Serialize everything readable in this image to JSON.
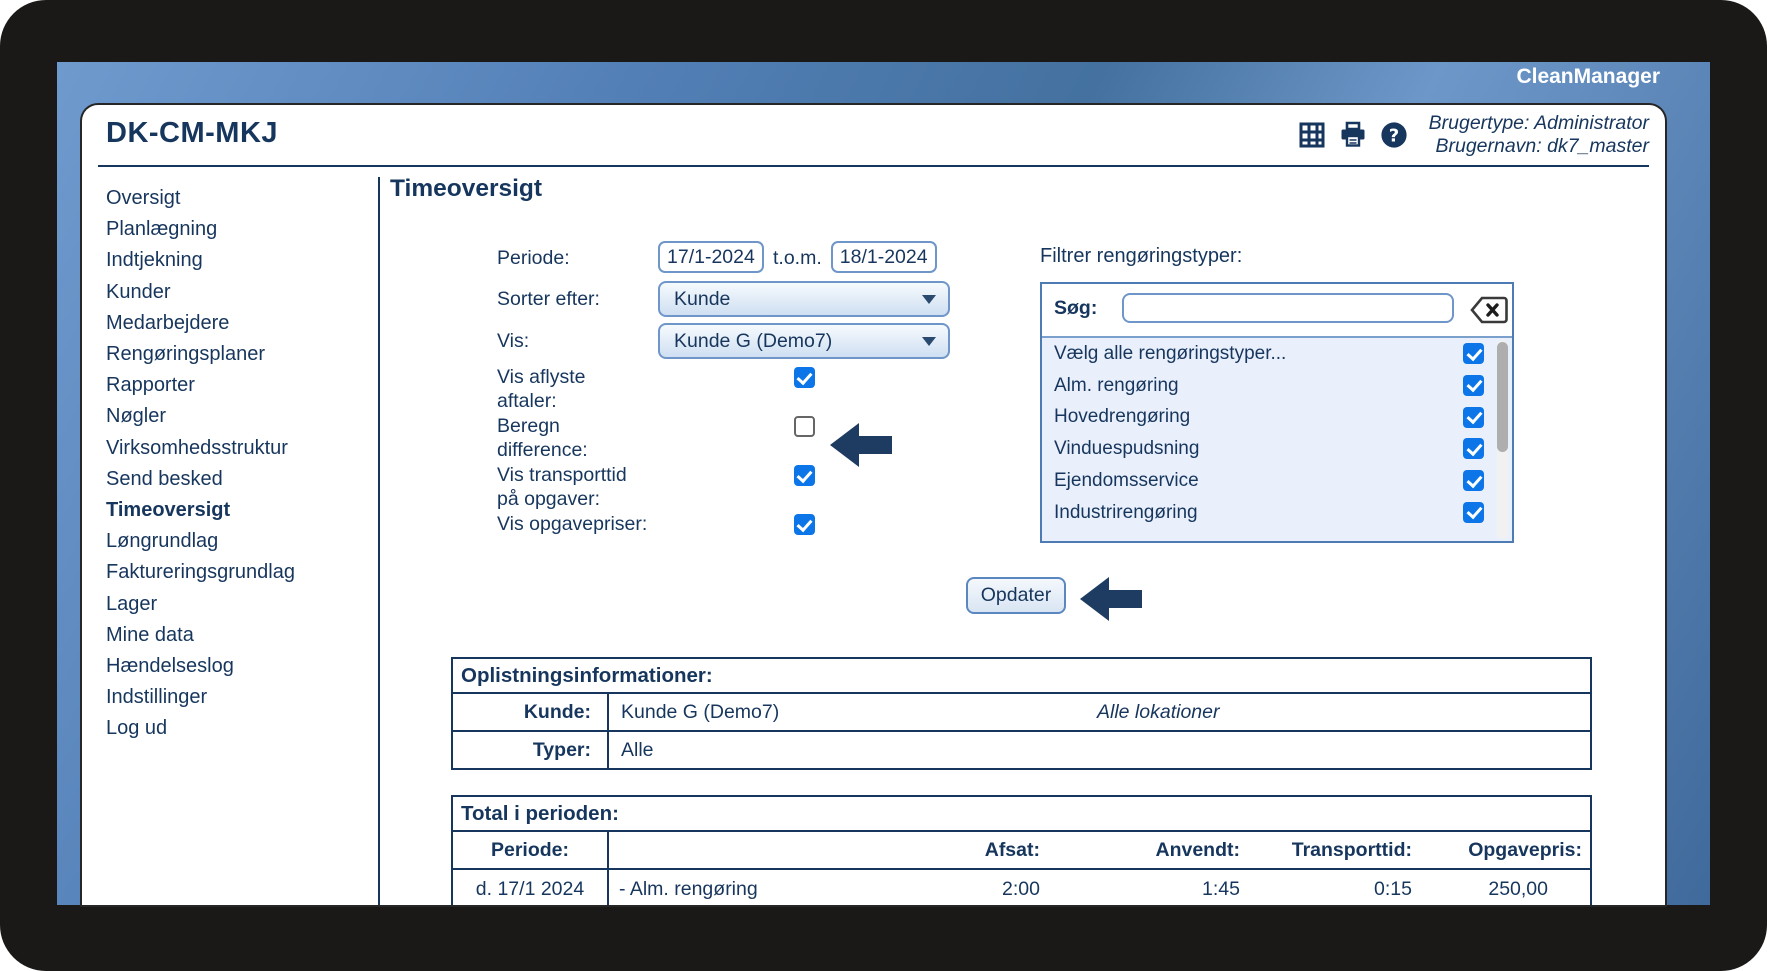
{
  "brand": "CleanManager",
  "header": {
    "app_title": "DK-CM-MKJ",
    "usertype": "Brugertype: Administrator",
    "username": "Brugernavn: dk7_master"
  },
  "sidebar": {
    "items": [
      "Oversigt",
      "Planlægning",
      "Indtjekning",
      "Kunder",
      "Medarbejdere",
      "Rengøringsplaner",
      "Rapporter",
      "Nøgler",
      "Virksomhedsstruktur",
      "Send besked",
      "Timeoversigt",
      "Løngrundlag",
      "Faktureringsgrundlag",
      "Lager",
      "Mine data",
      "Hændelseslog",
      "Indstillinger",
      "Log ud"
    ],
    "active_item": "Timeoversigt"
  },
  "page": {
    "title": "Timeoversigt"
  },
  "form": {
    "periode_label": "Periode:",
    "periode_from": "17/1-2024",
    "tom_label": "t.o.m.",
    "periode_to": "18/1-2024",
    "sorter_label": "Sorter efter:",
    "sorter_value": "Kunde",
    "vis_label": "Vis:",
    "vis_value": "Kunde G (Demo7)",
    "checks": [
      {
        "label": "Vis aflyste aftaler:",
        "checked": true
      },
      {
        "label": "Beregn difference:",
        "checked": false
      },
      {
        "label": "Vis transporttid på opgaver:",
        "checked": true
      },
      {
        "label": "Vis opgavepriser:",
        "checked": true
      }
    ],
    "update_button": "Opdater"
  },
  "filter": {
    "title": "Filtrer rengøringstyper:",
    "search_label": "Søg:",
    "search_value": "",
    "items": [
      {
        "label": "Vælg alle rengøringstyper...",
        "checked": true
      },
      {
        "label": "Alm. rengøring",
        "checked": true
      },
      {
        "label": "Hovedrengøring",
        "checked": true
      },
      {
        "label": "Vinduespudsning",
        "checked": true
      },
      {
        "label": "Ejendomsservice",
        "checked": true
      },
      {
        "label": "Industrirengøring",
        "checked": true
      }
    ]
  },
  "info_table": {
    "title": "Oplistningsinformationer:",
    "rows": [
      {
        "label": "Kunde:",
        "value": "Kunde G (Demo7)",
        "note": "Alle lokationer"
      },
      {
        "label": "Typer:",
        "value": "Alle",
        "note": ""
      }
    ]
  },
  "total_table": {
    "title": "Total i perioden:",
    "headers": [
      "Periode:",
      "",
      "Afsat:",
      "Anvendt:",
      "Transporttid:",
      "Opgavepris:"
    ],
    "rows": [
      {
        "periode": "d. 17/1 2024",
        "type": "- Alm. rengøring",
        "afsat": "2:00",
        "anvendt": "1:45",
        "transporttid": "0:15",
        "opgavepris": "250,00"
      }
    ]
  },
  "colors": {
    "navy_text": "#17365D",
    "checkbox_blue": "#0C76E9",
    "filter_border_blue": "#4D7CB4",
    "frame_black": "#1B1918",
    "background_blue": "#5585BF",
    "filter_list_bg": "#E9F0FC"
  }
}
